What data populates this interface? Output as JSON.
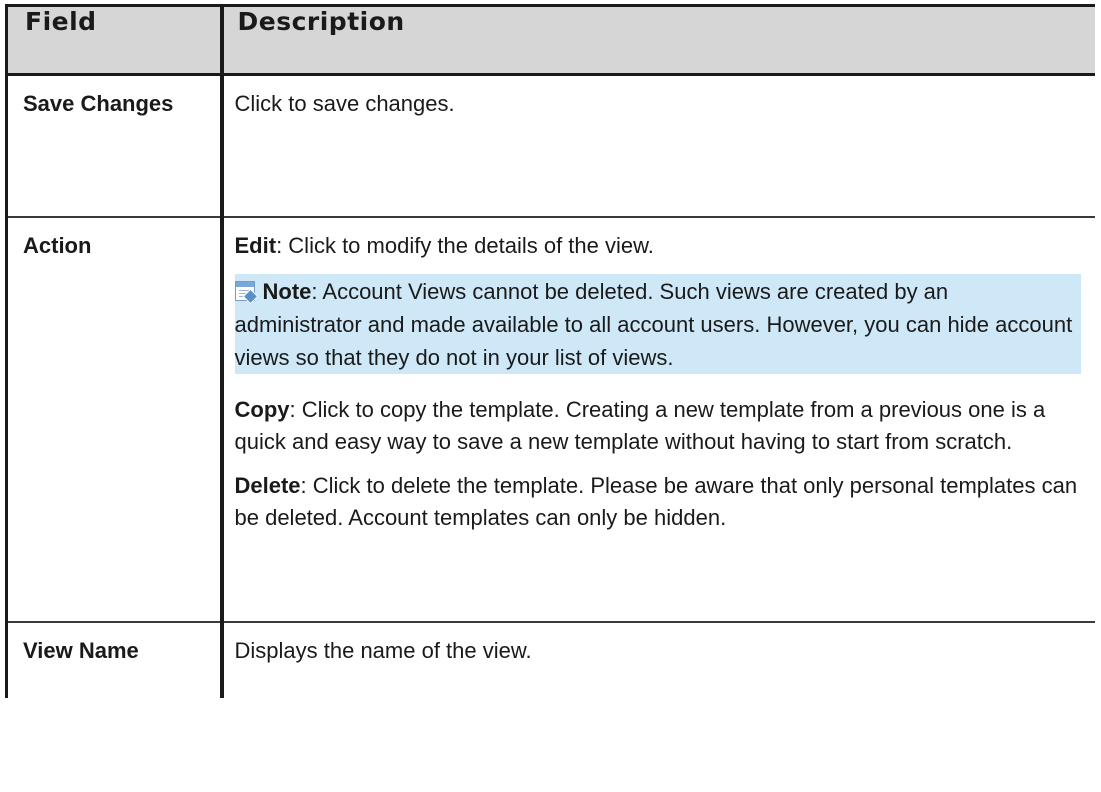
{
  "table": {
    "headers": {
      "field": "Field",
      "description": "Description"
    },
    "rows": [
      {
        "field": "Save Changes",
        "description": "Click to save changes."
      },
      {
        "field": "Action",
        "edit": {
          "term": "Edit",
          "text": ": Click to modify the details of the view."
        },
        "note": {
          "icon": "note-icon",
          "term": "Note",
          "text": ": Account Views cannot be deleted. Such views are created by an administrator and made available to all account users. However, you can hide account views so that they do not in your list of views."
        },
        "copy": {
          "term": "Copy",
          "text": ": Click to copy the template. Creating a new template from a previous one is a quick and easy way to save a new template without having to start from scratch."
        },
        "delete": {
          "term": "Delete",
          "text": ": Click to delete the template. Please be aware that only personal templates can be deleted. Account templates can only be hidden."
        }
      },
      {
        "field": "View Name",
        "description": "Displays the name of the view."
      }
    ]
  },
  "colors": {
    "header_bg": "#d6d6d6",
    "note_bg": "#cfe8f8",
    "border": "#1a1a1a"
  }
}
